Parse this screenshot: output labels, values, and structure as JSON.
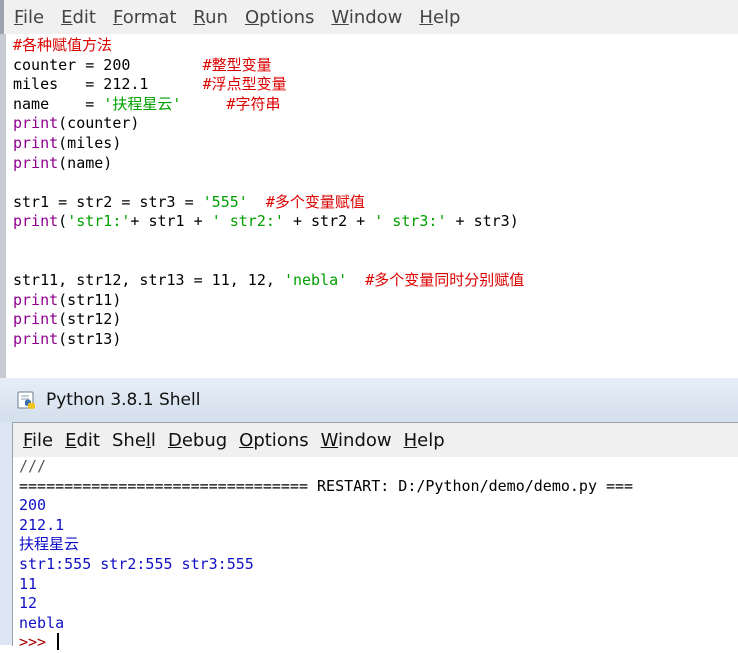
{
  "editor": {
    "menu": [
      "File",
      "Edit",
      "Format",
      "Run",
      "Options",
      "Window",
      "Help"
    ],
    "code": [
      [
        {
          "t": "#各种赋值方法",
          "c": "cmt"
        }
      ],
      [
        {
          "t": "counter = 200        ",
          "c": ""
        },
        {
          "t": "#整型变量",
          "c": "cmt"
        }
      ],
      [
        {
          "t": "miles   = 212.1      ",
          "c": ""
        },
        {
          "t": "#浮点型变量",
          "c": "cmt"
        }
      ],
      [
        {
          "t": "name    = ",
          "c": ""
        },
        {
          "t": "'扶程星云'",
          "c": "str"
        },
        {
          "t": "     ",
          "c": ""
        },
        {
          "t": "#字符串",
          "c": "cmt"
        }
      ],
      [
        {
          "t": "print",
          "c": "kw"
        },
        {
          "t": "(counter)",
          "c": ""
        }
      ],
      [
        {
          "t": "print",
          "c": "kw"
        },
        {
          "t": "(miles)",
          "c": ""
        }
      ],
      [
        {
          "t": "print",
          "c": "kw"
        },
        {
          "t": "(name)",
          "c": ""
        }
      ],
      [],
      [
        {
          "t": "str1 = str2 = str3 = ",
          "c": ""
        },
        {
          "t": "'555'",
          "c": "str"
        },
        {
          "t": "  ",
          "c": ""
        },
        {
          "t": "#多个变量赋值",
          "c": "cmt"
        }
      ],
      [
        {
          "t": "print",
          "c": "kw"
        },
        {
          "t": "(",
          "c": ""
        },
        {
          "t": "'str1:'",
          "c": "str"
        },
        {
          "t": "+ str1 + ",
          "c": ""
        },
        {
          "t": "' str2:'",
          "c": "str"
        },
        {
          "t": " + str2 + ",
          "c": ""
        },
        {
          "t": "' str3:'",
          "c": "str"
        },
        {
          "t": " + str3)",
          "c": ""
        }
      ],
      [],
      [],
      [
        {
          "t": "str11, str12, str13 = 11, 12, ",
          "c": ""
        },
        {
          "t": "'nebla'",
          "c": "str"
        },
        {
          "t": "  ",
          "c": ""
        },
        {
          "t": "#多个变量同时分别赋值",
          "c": "cmt"
        }
      ],
      [
        {
          "t": "print",
          "c": "kw"
        },
        {
          "t": "(str11)",
          "c": ""
        }
      ],
      [
        {
          "t": "print",
          "c": "kw"
        },
        {
          "t": "(str12)",
          "c": ""
        }
      ],
      [
        {
          "t": "print",
          "c": "kw"
        },
        {
          "t": "(str13)",
          "c": ""
        }
      ]
    ]
  },
  "shell": {
    "title": "Python 3.8.1 Shell",
    "menu": [
      "File",
      "Edit",
      "Shell",
      "Debug",
      "Options",
      "Window",
      "Help"
    ],
    "output": [
      {
        "t": "///",
        "c": "out-dim"
      },
      {
        "t": "================================ RESTART: D:/Python/demo/demo.py ===",
        "c": ""
      },
      {
        "t": "200",
        "c": "out-blue"
      },
      {
        "t": "212.1",
        "c": "out-blue"
      },
      {
        "t": "扶程星云",
        "c": "out-blue"
      },
      {
        "t": "str1:555 str2:555 str3:555",
        "c": "out-blue"
      },
      {
        "t": "11",
        "c": "out-blue"
      },
      {
        "t": "12",
        "c": "out-blue"
      },
      {
        "t": "nebla",
        "c": "out-blue"
      }
    ],
    "prompt": ">>>"
  }
}
